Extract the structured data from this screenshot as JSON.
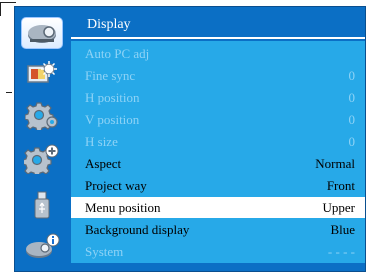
{
  "header": {
    "title": "Display"
  },
  "sidebar": {
    "items": [
      {
        "icon": "display-icon",
        "active": true
      },
      {
        "icon": "image-settings-icon",
        "active": false
      },
      {
        "icon": "gear-icon",
        "active": false
      },
      {
        "icon": "gear-plus-icon",
        "active": false
      },
      {
        "icon": "usb-icon",
        "active": false
      },
      {
        "icon": "info-icon",
        "active": false
      }
    ]
  },
  "menu": {
    "items": [
      {
        "label": "Auto PC adj",
        "value": "",
        "state": "disabled"
      },
      {
        "label": "Fine sync",
        "value": "0",
        "state": "disabled"
      },
      {
        "label": "H position",
        "value": "0",
        "state": "disabled"
      },
      {
        "label": "V position",
        "value": "0",
        "state": "disabled"
      },
      {
        "label": "H size",
        "value": "0",
        "state": "disabled"
      },
      {
        "label": "Aspect",
        "value": "Normal",
        "state": "enabled"
      },
      {
        "label": "Project way",
        "value": "Front",
        "state": "enabled"
      },
      {
        "label": "Menu position",
        "value": "Upper",
        "state": "selected"
      },
      {
        "label": "Background display",
        "value": "Blue",
        "state": "enabled"
      },
      {
        "label": "System",
        "value": "- - - -",
        "state": "disabled"
      }
    ]
  },
  "colors": {
    "frame": "#0b6fc5",
    "menu_background": "#27a9e8",
    "disabled_text": "#8ed3f6",
    "selected_row": "#ffffff"
  }
}
